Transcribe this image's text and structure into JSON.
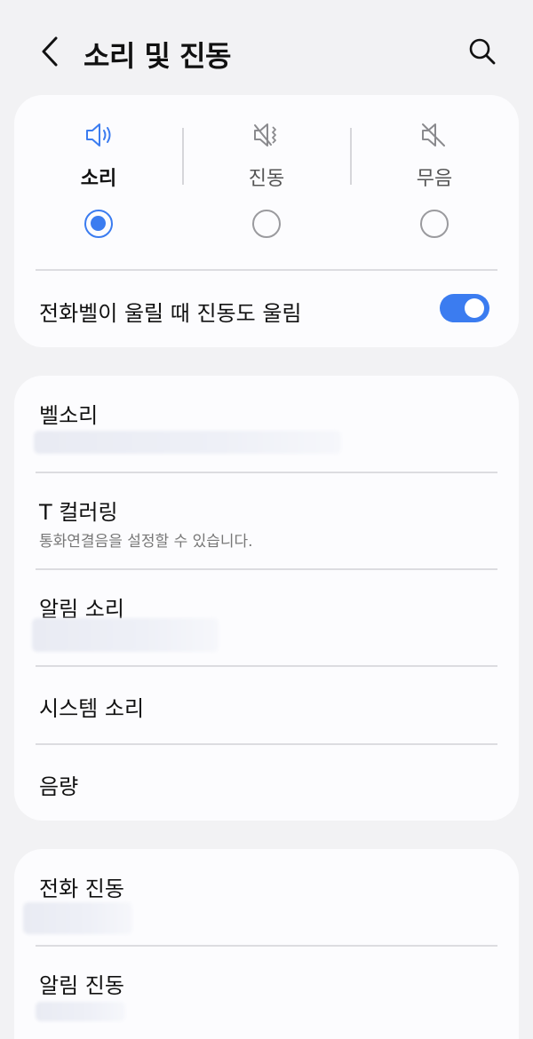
{
  "header": {
    "title": "소리 및 진동",
    "back_icon": "chevron-left-icon",
    "search_icon": "search-icon"
  },
  "sound_mode": {
    "selected": "sound",
    "options": [
      {
        "id": "sound",
        "label": "소리",
        "icon": "speaker-on-icon"
      },
      {
        "id": "vibrate",
        "label": "진동",
        "icon": "vibrate-icon"
      },
      {
        "id": "mute",
        "label": "무음",
        "icon": "speaker-mute-icon"
      }
    ]
  },
  "vibrate_while_ringing": {
    "label": "전화벨이 울릴 때 진동도 울림",
    "enabled": true
  },
  "settings_group": {
    "items": [
      {
        "title": "벨소리",
        "subtitle_hidden": true
      },
      {
        "title": "T 컬러링",
        "subtitle": "통화연결음을 설정할 수 있습니다."
      },
      {
        "title": "알림 소리",
        "subtitle_hidden": true
      },
      {
        "title": "시스템 소리"
      },
      {
        "title": "음량"
      }
    ]
  },
  "vibration_group": {
    "items": [
      {
        "title": "전화 진동",
        "subtitle_hidden": true
      },
      {
        "title": "알림 진동",
        "subtitle_hidden": true
      }
    ]
  },
  "colors": {
    "accent": "#3b7cf0",
    "background": "#f2f2f4",
    "card": "#fcfcfe",
    "divider": "#dcdce0"
  }
}
